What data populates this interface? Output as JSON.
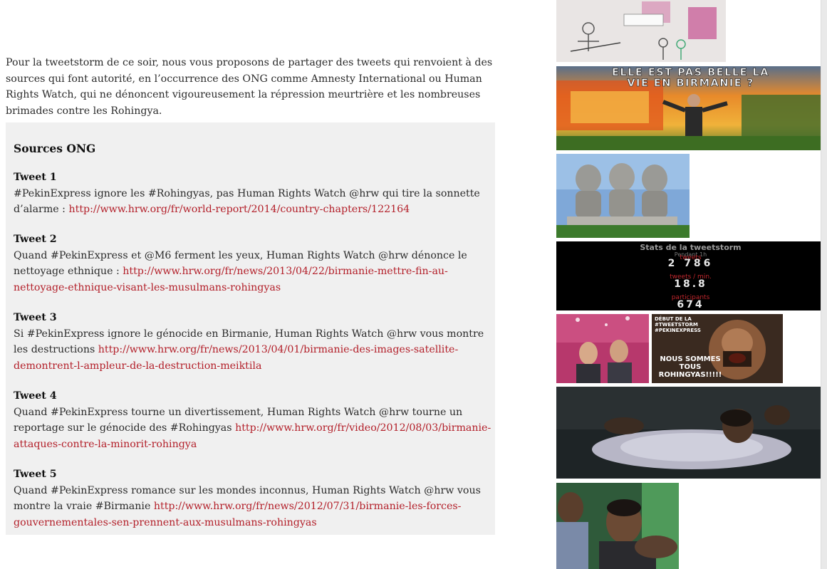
{
  "intro": "Pour la tweetstorm de ce soir, nous vous proposons de partager des tweets qui renvoient à des sources qui font autorité, en l’occurrence des ONG comme Amnesty International ou Human Rights Watch, qui ne dénoncent vigoureusement la répression meurtrière et les nombreuses brimades contre les Rohingya.",
  "sources": {
    "title": "Sources ONG",
    "tweets": [
      {
        "heading": "Tweet 1",
        "text": "#PekinExpress ignore les #Rohingyas, pas Human Rights Watch @hrw qui tire la sonnette d’alarme : ",
        "link": "http://www.hrw.org/fr/world-report/2014/country-chapters/122164"
      },
      {
        "heading": "Tweet 2",
        "text": "Quand #PekinExpress et @M6 ferment les yeux, Human Rights Watch @hrw dénonce le nettoyage ethnique : ",
        "link": "http://www.hrw.org/fr/news/2013/04/22/birmanie-mettre-fin-au-nettoyage-ethnique-visant-les-musulmans-rohingyas"
      },
      {
        "heading": "Tweet 3",
        "text": "Si #PekinExpress ignore le génocide en Birmanie, Human Rights Watch @hrw vous montre les destructions ",
        "link": "http://www.hrw.org/fr/news/2013/04/01/birmanie-des-images-satellite-demontrent-l-ampleur-de-la-destruction-meiktila"
      },
      {
        "heading": "Tweet 4",
        "text": "Quand #PekinExpress tourne un divertissement, Human Rights Watch @hrw tourne un reportage sur le génocide des #Rohingyas ",
        "link": "http://www.hrw.org/fr/video/2012/08/03/birmanie-attaques-contre-la-minorit-rohingya"
      },
      {
        "heading": "Tweet 5",
        "text": "Quand #PekinExpress romance sur les mondes inconnus, Human Rights Watch @hrw vous montre la vraie #Birmanie ",
        "link": "http://www.hrw.org/fr/news/2012/07/31/birmanie-les-forces-gouvernementales-sen-prennent-aux-musulmans-rohingyas"
      }
    ]
  },
  "images": {
    "meme_caption": "ELLE EST PAS BELLE LA VIE EN BIRMANIE ?",
    "stats_title": "Stats de la tweetstorm",
    "stats_sub": "Pendant 1h",
    "stats_tweets_label": "tweets",
    "stats_tweets_value": "2 786",
    "stats_rate_label": "tweets / min.",
    "stats_rate_value": "18.8",
    "stats_participants_label": "participants",
    "stats_participants_value": "674",
    "spartan_top": "DÉBUT DE LA #TWEETSTORM #PEKINEXPRESS",
    "spartan_bottom": "NOUS SOMMES TOUS ROHINGYAS!!!!!"
  }
}
